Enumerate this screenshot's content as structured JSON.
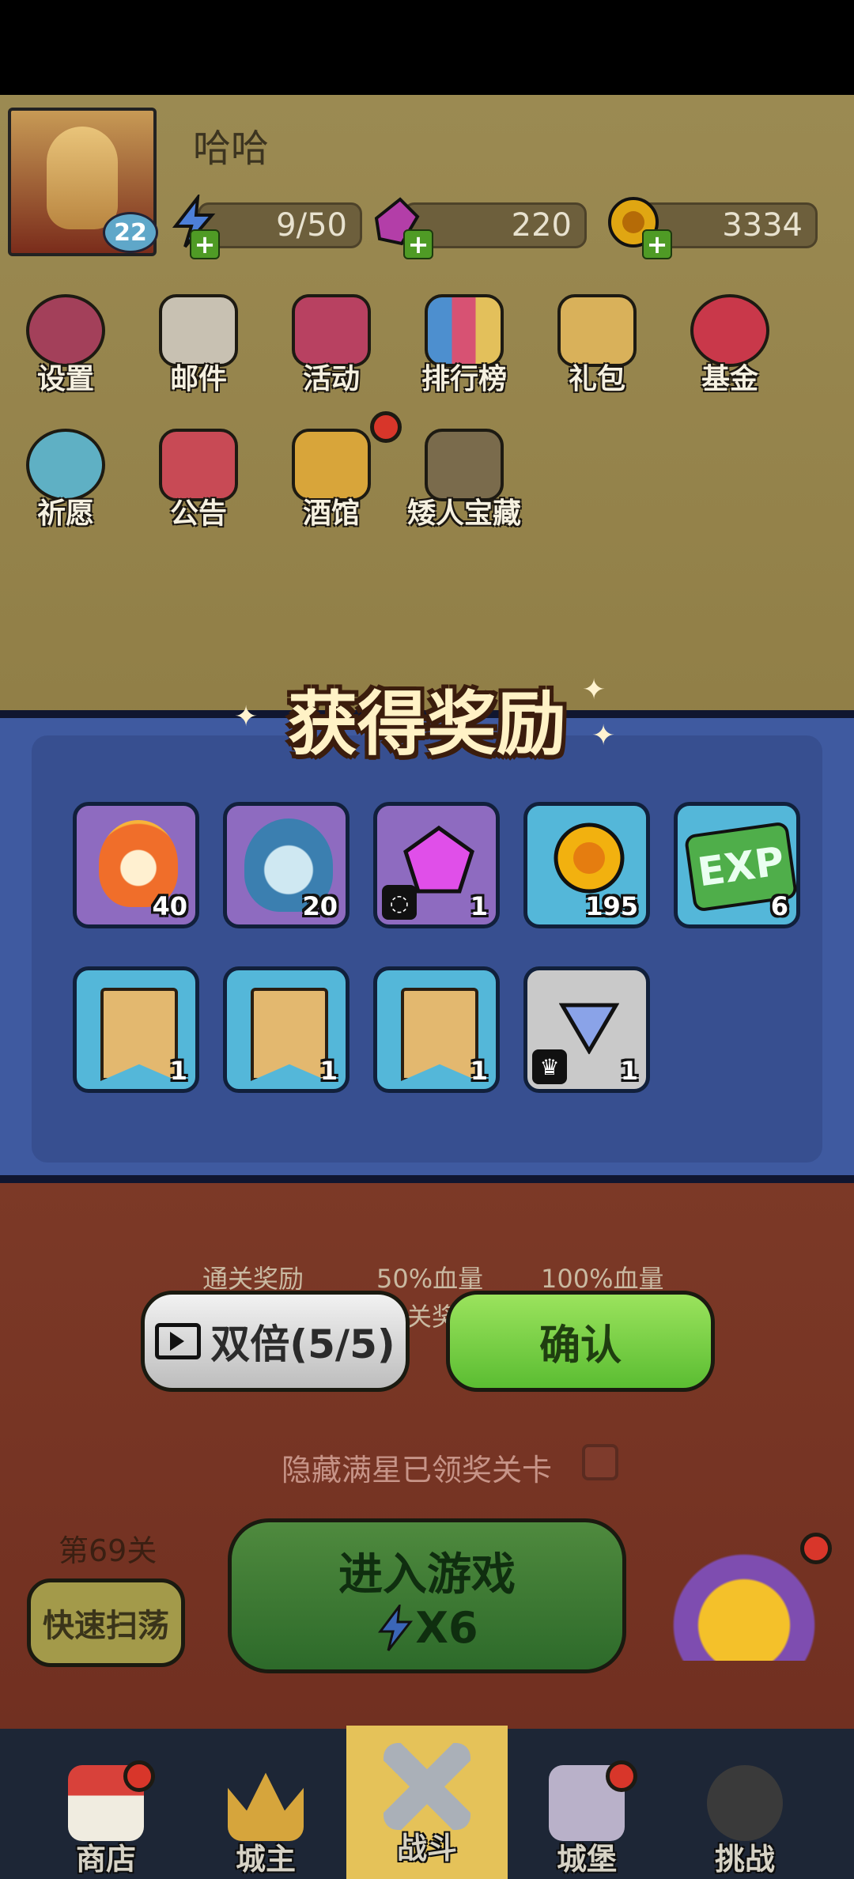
{
  "player": {
    "name": "哈哈",
    "level": "22"
  },
  "resources": [
    {
      "name": "energy",
      "icon": "lightning-icon",
      "value": "9/50"
    },
    {
      "name": "gems",
      "icon": "gem-icon",
      "value": "220"
    },
    {
      "name": "gold",
      "icon": "gold-coin-icon",
      "value": "3334"
    }
  ],
  "menu": {
    "row1": [
      "设置",
      "邮件",
      "活动",
      "排行榜",
      "礼包",
      "基金"
    ],
    "row2": [
      "祈愿",
      "公告",
      "酒馆",
      "矮人宝藏"
    ]
  },
  "reward_panel": {
    "title": "获得奖励",
    "items": [
      {
        "icon": "fire-hero-icon",
        "count": "40"
      },
      {
        "icon": "blue-goblin-hero-icon",
        "count": "20"
      },
      {
        "icon": "pink-gem-icon",
        "count": "1"
      },
      {
        "icon": "gold-coin-icon",
        "count": "195"
      },
      {
        "icon": "exp-icon",
        "label": "EXP",
        "count": "6"
      },
      {
        "icon": "ring-scroll-icon",
        "count": "1"
      },
      {
        "icon": "necklace-scroll-icon",
        "count": "1"
      },
      {
        "icon": "armor-scroll-icon",
        "count": "1"
      },
      {
        "icon": "blue-triangle-icon",
        "count": "1"
      }
    ]
  },
  "behind_panel": {
    "chest_labels": [
      "通关奖励",
      "50%血量",
      "100%血量"
    ],
    "partial_text": "关奖"
  },
  "buttons": {
    "double": "双倍(5/5)",
    "confirm": "确认"
  },
  "hide_option": "隐藏满星已领奖关卡",
  "stage": {
    "label": "第69关",
    "sweep": "快速扫荡",
    "enter": "进入游戏",
    "cost": "X6"
  },
  "nav": [
    "商店",
    "城主",
    "战斗",
    "城堡",
    "挑战"
  ],
  "colors": {
    "panel": "#3f5aa0",
    "confirm": "#6fcb3e",
    "title": "#fff2c6"
  }
}
